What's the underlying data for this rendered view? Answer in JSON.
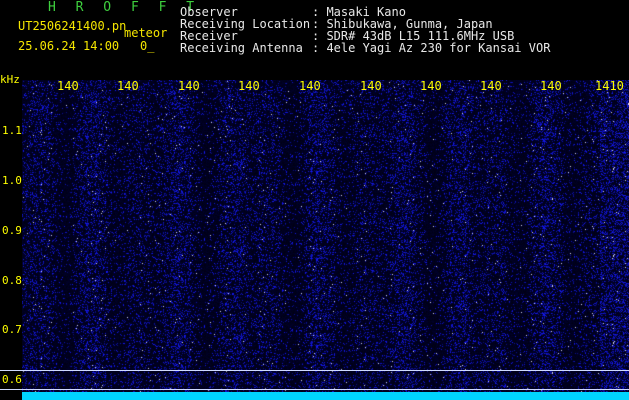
{
  "header": {
    "title": "H R O F F T",
    "filename": "UT2506241400.pn",
    "mode_label": "meteor",
    "datetime": "25.06.24 14:00",
    "count": "0_",
    "fields": [
      {
        "label": "Observer",
        "value": ": Masaki Kano"
      },
      {
        "label": "Receiving Location",
        "value": ": Shibukawa, Gunma, Japan"
      },
      {
        "label": "Receiver",
        "value": ": SDR# 43dB L15 111.6MHz USB"
      },
      {
        "label": "Receiving Antenna",
        "value": ": 4ele Yagi Az 230 for Kansai VOR"
      }
    ]
  },
  "axes": {
    "y_unit": "kHz",
    "y_ticks": [
      "1.1",
      "1.0",
      "0.9",
      "0.8",
      "0.7",
      "0.6"
    ],
    "x_ticks": [
      "140",
      "140",
      "140",
      "140",
      "140",
      "140",
      "140",
      "140",
      "140",
      "1410"
    ]
  },
  "colors": {
    "background": "#000000",
    "header_text": "#e8e8e8",
    "axis_text": "#ffff00",
    "title": "#3ecf3e",
    "band": "#00d4ff",
    "noise": "#1a1aff"
  }
}
